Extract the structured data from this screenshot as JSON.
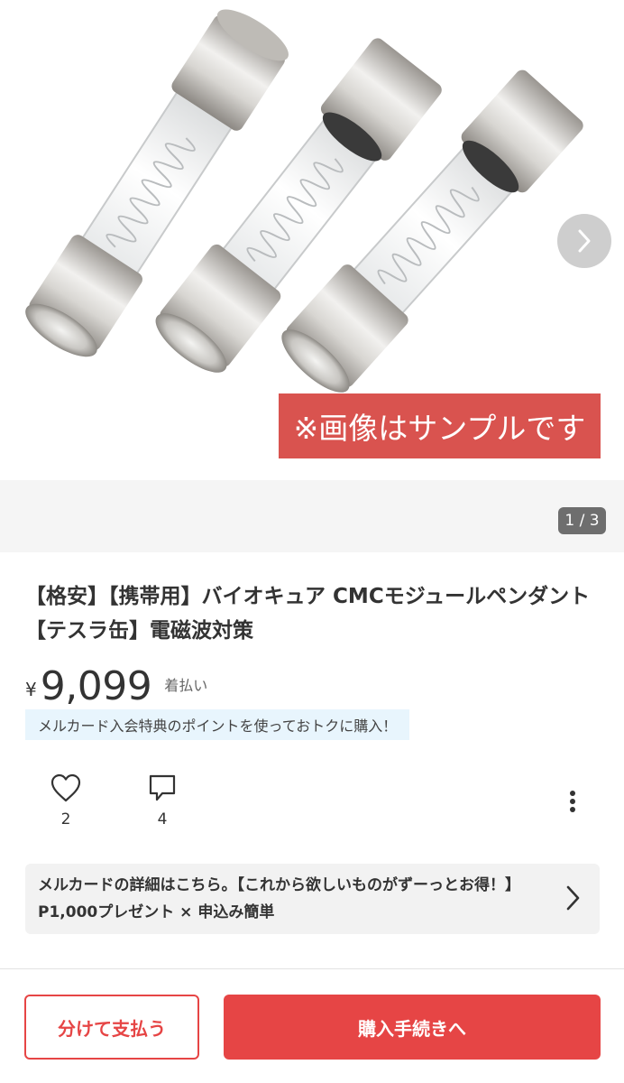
{
  "gallery": {
    "sample_label": "※画像はサンプルです",
    "counter": "1 / 3"
  },
  "product": {
    "title": "【格安】【携帯用】バイオキュア CMCモジュールペンダント【テスラ缶】電磁波対策",
    "currency": "¥",
    "price": "9,099",
    "shipping": "着払い",
    "promo": "メルカード入会特典のポイントを使っておトクに購入！"
  },
  "actions": {
    "like_count": "2",
    "comment_count": "4"
  },
  "banner": {
    "text": "メルカードの詳細はこちら。【これから欲しいものがずーっとお得！】P1,000プレゼント × 申込み簡単"
  },
  "bottom_bar": {
    "split_label": "分けて支払う",
    "buy_label": "購入手続きへ"
  },
  "colors": {
    "accent": "#e64545",
    "sample_label_bg": "#d9534f",
    "promo_bg": "#e8f5fd"
  },
  "icons": [
    "chevron-right-icon",
    "heart-icon",
    "comment-icon",
    "more-vertical-icon"
  ]
}
